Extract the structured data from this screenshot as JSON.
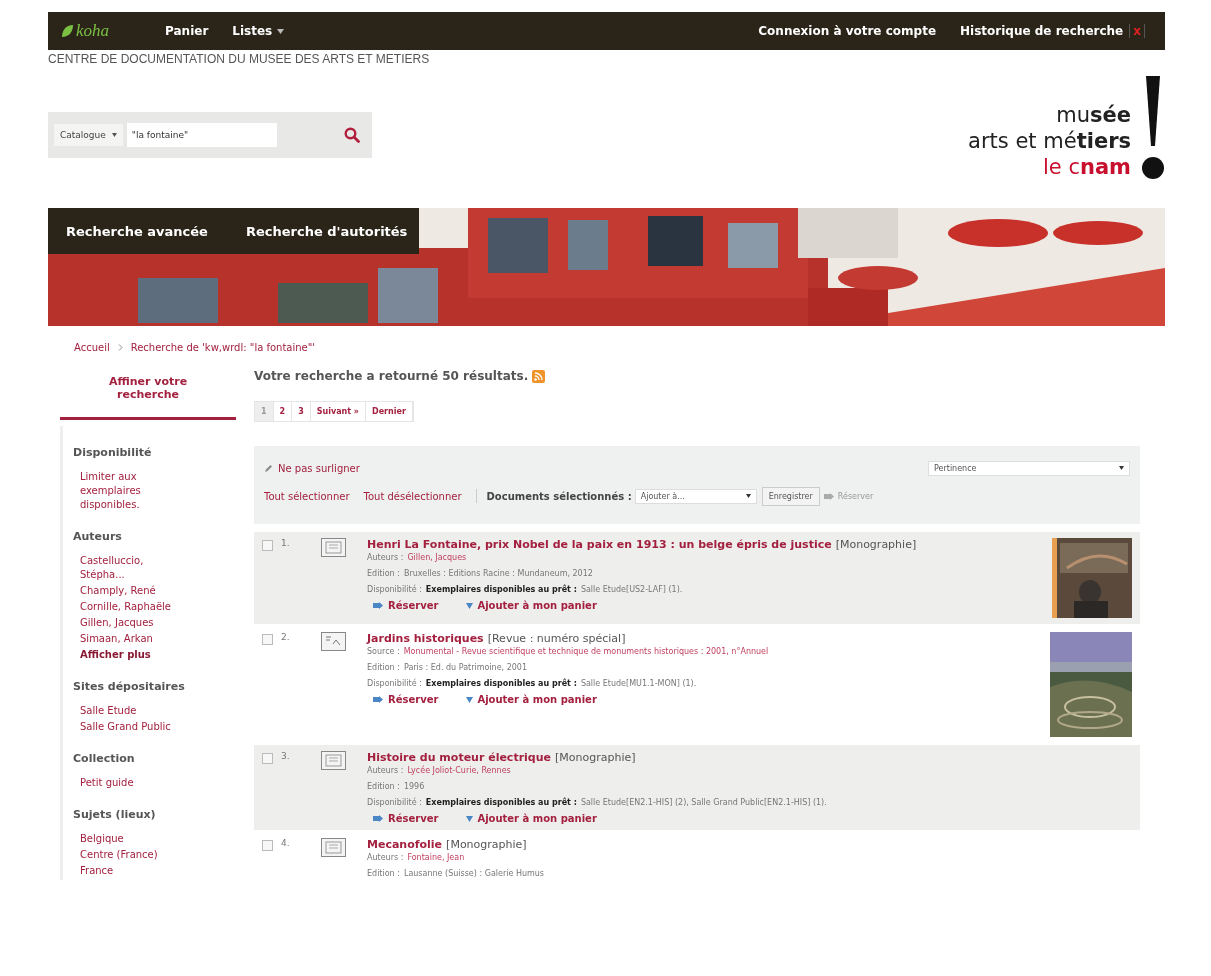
{
  "navbar": {
    "logo": "koha",
    "items": [
      {
        "label": "Panier",
        "dropdown": false
      },
      {
        "label": "Listes",
        "dropdown": true
      }
    ],
    "login": "Connexion à votre compte",
    "history": "Historique de recherche",
    "history_clear": "x"
  },
  "library_name": "CENTRE DE DOCUMENTATION DU MUSEE DES ARTS ET METIERS",
  "search": {
    "scope": "Catalogue",
    "value": "\"la fontaine\""
  },
  "brand_logo": {
    "lines": [
      "mu**sée**",
      "arts et mé**tiers**",
      "le c**nam**"
    ]
  },
  "banner": {
    "menu": [
      "Recherche avancée",
      "Recherche d'autorités"
    ]
  },
  "breadcrumb": [
    "Accueil",
    "Recherche de 'kw,wrdl: \"la fontaine\"'"
  ],
  "sidebar": {
    "title": "Affiner votre recherche",
    "facets": [
      {
        "heading": "Disponibilité",
        "items": [
          {
            "label": "Limiter aux exemplaires disponibles.",
            "kind": "link"
          }
        ]
      },
      {
        "heading": "Auteurs",
        "items": [
          {
            "label": "Castelluccio, Stépha...",
            "kind": "link"
          },
          {
            "label": "Champly, René",
            "kind": "link"
          },
          {
            "label": "Cornille, Raphaële",
            "kind": "link"
          },
          {
            "label": "Gillen, Jacques",
            "kind": "link"
          },
          {
            "label": "Simaan, Arkan",
            "kind": "link"
          },
          {
            "label": "Afficher plus",
            "kind": "more"
          }
        ]
      },
      {
        "heading": "Sites dépositaires",
        "items": [
          {
            "label": "Salle Etude",
            "kind": "link"
          },
          {
            "label": "Salle Grand Public",
            "kind": "link"
          }
        ]
      },
      {
        "heading": "Collection",
        "items": [
          {
            "label": "Petit guide",
            "kind": "link"
          }
        ]
      },
      {
        "heading": "Sujets (lieux)",
        "items": [
          {
            "label": "Belgique",
            "kind": "link"
          },
          {
            "label": "Centre (France)",
            "kind": "link"
          },
          {
            "label": "France",
            "kind": "link"
          }
        ]
      }
    ]
  },
  "results_heading": "Votre recherche a retourné 50 résultats.",
  "pagination": [
    {
      "label": "1",
      "selected": true
    },
    {
      "label": "2",
      "selected": false
    },
    {
      "label": "3",
      "selected": false
    },
    {
      "label": "Suivant »",
      "selected": false
    },
    {
      "label": "Dernier",
      "selected": false
    }
  ],
  "toolbar": {
    "highlight": "Ne pas surligner",
    "sort": "Pertinence",
    "select_all": "Tout sélectionner",
    "clear_all": "Tout désélectionner",
    "selected_label": "Documents sélectionnés :",
    "add_to": "Ajouter à...",
    "save": "Enregistrer",
    "hold": "Réserver"
  },
  "results": [
    {
      "number": "1.",
      "checked": false,
      "kind": "book",
      "title": "Henri La Fontaine, prix Nobel de la paix en 1913 : un belge épris de justice",
      "type": "[Monographie]",
      "detail_label": "Auteurs :",
      "detail": "Gillen, Jacques",
      "edition_label": "Edition :",
      "edition": "Bruxelles : Editions Racine : Mundaneum, 2012",
      "availability_label": "Disponibilité :",
      "availability_bold": "Exemplaires disponibles au prêt :",
      "availability": "Salle Etude[US2-LAF] (1).",
      "actions": [
        "Réserver",
        "Ajouter à mon panier"
      ],
      "cover": true
    },
    {
      "number": "2.",
      "checked": false,
      "kind": "serial",
      "title": "Jardins historiques",
      "type": "[Revue : numéro spécial]",
      "detail_label": "Source :",
      "detail": "Monumental - Revue scientifique et technique de monuments historiques : 2001, n°Annuel",
      "edition_label": "Edition :",
      "edition": "Paris : Ed. du Patrimoine, 2001",
      "availability_label": "Disponibilité :",
      "availability_bold": "Exemplaires disponibles au prêt :",
      "availability": "Salle Etude[MU1.1-MON] (1).",
      "actions": [
        "Réserver",
        "Ajouter à mon panier"
      ],
      "cover": true
    },
    {
      "number": "3.",
      "checked": false,
      "kind": "book",
      "title": "Histoire du moteur électrique",
      "type": "[Monographie]",
      "detail_label": "Auteurs :",
      "detail": "Lycée Joliot-Curie, Rennes",
      "edition_label": "Edition :",
      "edition": "1996",
      "availability_label": "Disponibilité :",
      "availability_bold": "Exemplaires disponibles au prêt :",
      "availability": "Salle Etude[EN2.1-HIS] (2), Salle Grand Public[EN2.1-HIS] (1).",
      "actions": [
        "Réserver",
        "Ajouter à mon panier"
      ],
      "cover": false
    },
    {
      "number": "4.",
      "checked": false,
      "kind": "book",
      "title": "Mecanofolie",
      "type": "[Monographie]",
      "detail_label": "Auteurs :",
      "detail": "Fontaine, Jean",
      "edition_label": "Edition :",
      "edition": "Lausanne (Suisse) : Galerie Humus",
      "cover": false
    }
  ]
}
